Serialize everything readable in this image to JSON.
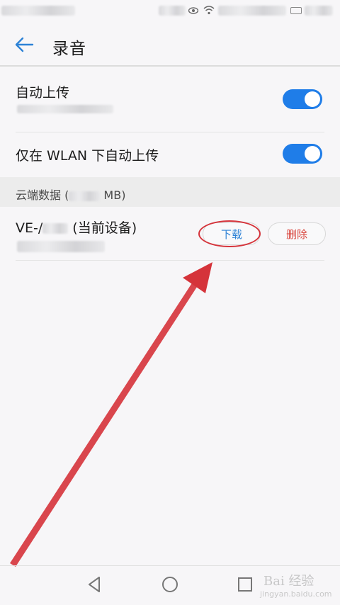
{
  "header": {
    "title": "录音"
  },
  "settings": {
    "auto_upload": {
      "label": "自动上传",
      "enabled": true
    },
    "wlan_upload": {
      "label": "仅在 WLAN 下自动上传",
      "enabled": true
    }
  },
  "cloud": {
    "section_prefix": "云端数据 (",
    "section_suffix": " MB)",
    "device": {
      "name_prefix": "VE-/",
      "name_suffix": " (当前设备)",
      "download_label": "下载",
      "delete_label": "删除"
    }
  },
  "watermark": {
    "main": "Bai 经验",
    "sub": "jingyan.baidu.com"
  },
  "colors": {
    "accent": "#1f7de8",
    "annotation": "#d5333a",
    "delete": "#d9443c"
  },
  "icons": {
    "back": "back-arrow-icon",
    "nav_back": "triangle-back-icon",
    "nav_home": "circle-home-icon",
    "nav_recent": "square-recent-icon"
  }
}
